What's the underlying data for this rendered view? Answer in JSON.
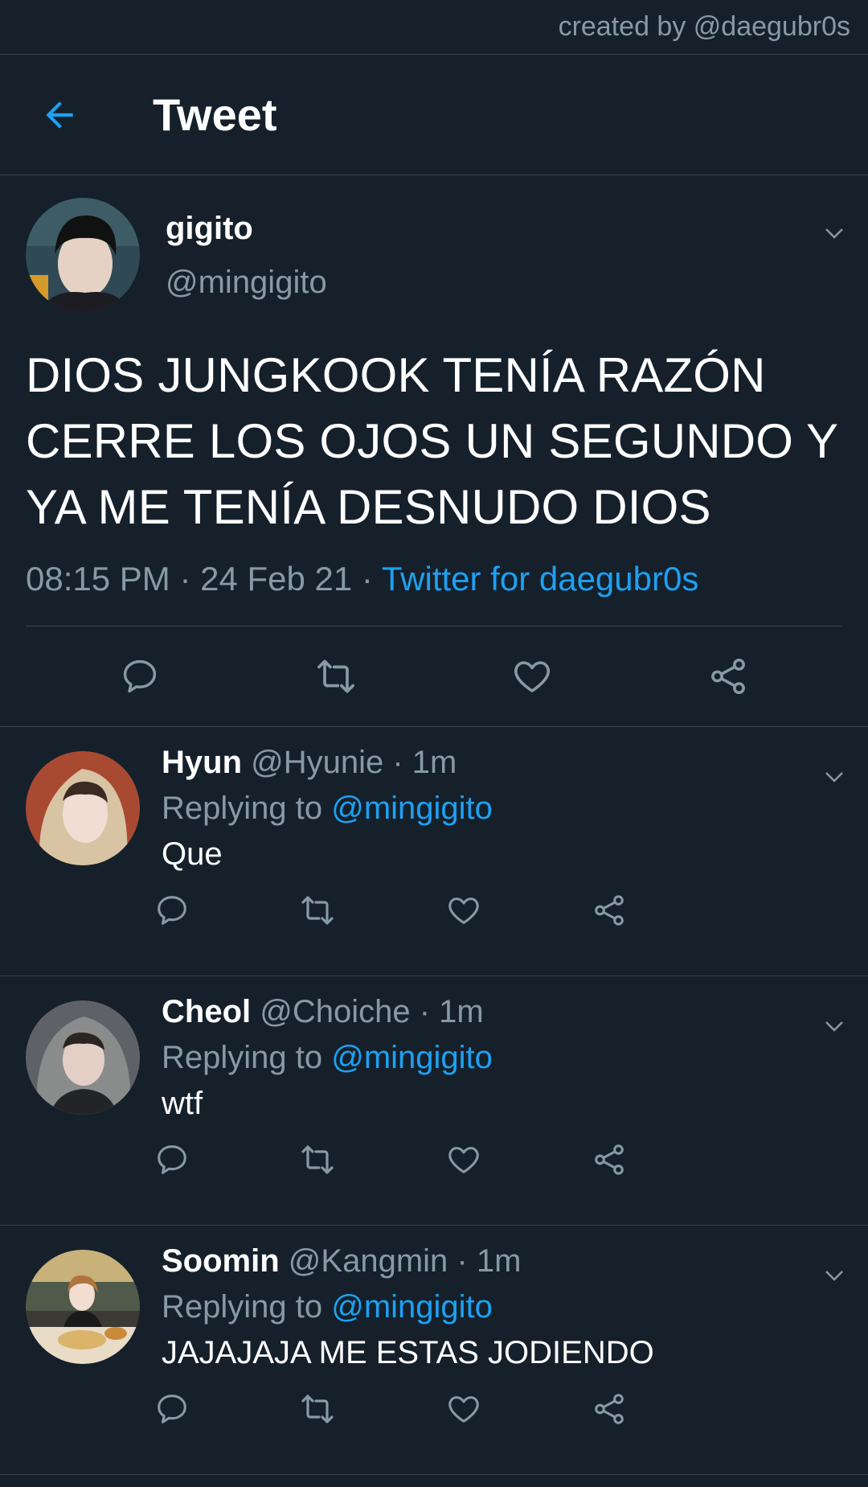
{
  "watermark": "created by @daegubr0s",
  "header": {
    "title": "Tweet"
  },
  "tweet": {
    "name": "gigito",
    "handle": "@mingigito",
    "text": "DIOS JUNGKOOK TENÍA RAZÓN CERRE LOS OJOS UN SEGUNDO Y YA ME TENÍA DESNUDO DIOS",
    "time": "08:15 PM · 24 Feb 21 · ",
    "source": "Twitter for daegubr0s"
  },
  "replies": [
    {
      "name": "Hyun",
      "handle": "@Hyunie",
      "time": "· 1m",
      "replying_prefix": "Replying to ",
      "replying_to": "@mingigito",
      "text": "Que"
    },
    {
      "name": "Cheol",
      "handle": "@Choiche",
      "time": "· 1m",
      "replying_prefix": "Replying to ",
      "replying_to": "@mingigito",
      "text": "wtf"
    },
    {
      "name": "Soomin",
      "handle": "@Kangmin",
      "time": "· 1m",
      "replying_prefix": "Replying to ",
      "replying_to": "@mingigito",
      "text": "JAJAJAJA ME ESTAS JODIENDO"
    }
  ],
  "icons": {
    "back": "arrow-left-icon",
    "caret": "chevron-down-icon",
    "reply": "comment-icon",
    "retweet": "retweet-icon",
    "like": "heart-icon",
    "share": "share-icon"
  },
  "colors": {
    "background": "#15202b",
    "accent": "#1da1f2",
    "muted": "#8899a6",
    "divider": "#38444d"
  }
}
